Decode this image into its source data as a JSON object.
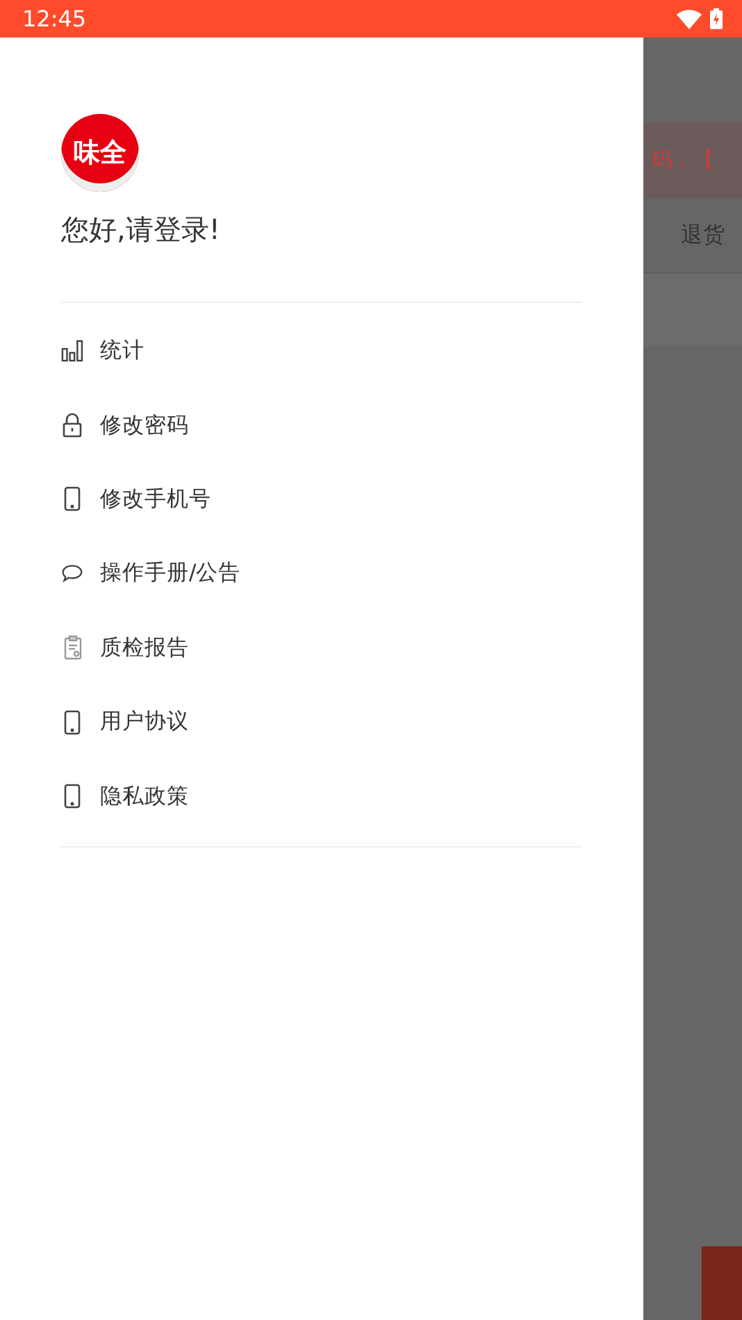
{
  "status_bar": {
    "time": "12:45"
  },
  "drawer": {
    "logo_text": "味全",
    "greeting": "您好,请登录!",
    "items": [
      {
        "label": "统计",
        "kind": "chart"
      },
      {
        "label": "修改密码",
        "kind": "lock"
      },
      {
        "label": "修改手机号",
        "kind": "phone"
      },
      {
        "label": "操作手册/公告",
        "kind": "chat"
      },
      {
        "label": "质检报告",
        "kind": "clipboard"
      },
      {
        "label": "用户协议",
        "kind": "phone"
      },
      {
        "label": "隐私政策",
        "kind": "phone"
      }
    ]
  },
  "background": {
    "notice_text": "码，【",
    "row_action": "退货"
  }
}
